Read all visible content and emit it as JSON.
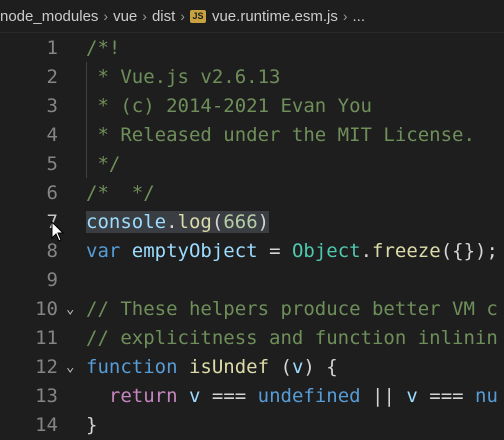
{
  "breadcrumb": {
    "items": [
      "node_modules",
      "vue",
      "dist",
      "vue.runtime.esm.js",
      "..."
    ],
    "file_icon": "JS"
  },
  "editor": {
    "lines": [
      {
        "n": "1",
        "tokens": [
          {
            "t": "/*!",
            "c": "c-cm"
          }
        ]
      },
      {
        "n": "2",
        "tokens": [
          {
            "t": " * Vue.js v2.6.13",
            "c": "c-cm"
          }
        ]
      },
      {
        "n": "3",
        "tokens": [
          {
            "t": " * (c) 2014-2021 Evan You",
            "c": "c-cm"
          }
        ]
      },
      {
        "n": "4",
        "tokens": [
          {
            "t": " * Released under the MIT License.",
            "c": "c-cm"
          }
        ]
      },
      {
        "n": "5",
        "tokens": [
          {
            "t": " */",
            "c": "c-cm"
          }
        ]
      },
      {
        "n": "6",
        "tokens": [
          {
            "t": "/*  */",
            "c": "c-cm"
          }
        ]
      },
      {
        "n": "7",
        "active": true,
        "tokens": [
          {
            "t": "console",
            "c": "var hl"
          },
          {
            "t": ".",
            "c": "punc hl"
          },
          {
            "t": "log",
            "c": "fn hl"
          },
          {
            "t": "(",
            "c": "punc hl"
          },
          {
            "t": "666",
            "c": "num hl"
          },
          {
            "t": ")",
            "c": "punc hl"
          }
        ]
      },
      {
        "n": "8",
        "tokens": [
          {
            "t": "var",
            "c": "kw"
          },
          {
            "t": " ",
            "c": "punc"
          },
          {
            "t": "emptyObject",
            "c": "var"
          },
          {
            "t": " = ",
            "c": "punc"
          },
          {
            "t": "Object",
            "c": "cls"
          },
          {
            "t": ".",
            "c": "punc"
          },
          {
            "t": "freeze",
            "c": "fn"
          },
          {
            "t": "({});",
            "c": "punc"
          }
        ]
      },
      {
        "n": "9",
        "tokens": []
      },
      {
        "n": "10",
        "fold": true,
        "tokens": [
          {
            "t": "// These helpers produce better VM c",
            "c": "c-cm"
          }
        ]
      },
      {
        "n": "11",
        "tokens": [
          {
            "t": "// explicitness and function inlinin",
            "c": "c-cm"
          }
        ]
      },
      {
        "n": "12",
        "fold": true,
        "tokens": [
          {
            "t": "function",
            "c": "kw"
          },
          {
            "t": " ",
            "c": "punc"
          },
          {
            "t": "isUndef",
            "c": "fn"
          },
          {
            "t": " (",
            "c": "punc"
          },
          {
            "t": "v",
            "c": "var"
          },
          {
            "t": ") {",
            "c": "punc"
          }
        ]
      },
      {
        "n": "13",
        "tokens": [
          {
            "t": "  ",
            "c": "punc"
          },
          {
            "t": "return",
            "c": "kw2"
          },
          {
            "t": " ",
            "c": "punc"
          },
          {
            "t": "v",
            "c": "var"
          },
          {
            "t": " === ",
            "c": "punc"
          },
          {
            "t": "undefined",
            "c": "kw"
          },
          {
            "t": " || ",
            "c": "punc"
          },
          {
            "t": "v",
            "c": "var"
          },
          {
            "t": " === ",
            "c": "punc"
          },
          {
            "t": "nu",
            "c": "kw"
          }
        ]
      },
      {
        "n": "14",
        "tokens": [
          {
            "t": "}",
            "c": "punc"
          }
        ]
      }
    ]
  },
  "colors": {
    "background": "#1e1e1e",
    "line_number": "#858585",
    "comment": "#6f8f5a",
    "keyword": "#569cd6",
    "function": "#dcdcaa",
    "variable": "#9cdcfe",
    "number": "#b5cea8",
    "class": "#4ec9b0"
  },
  "icons": {
    "fold": "chevron-down-icon",
    "file": "javascript-file-icon",
    "cursor": "mouse-pointer-icon"
  }
}
